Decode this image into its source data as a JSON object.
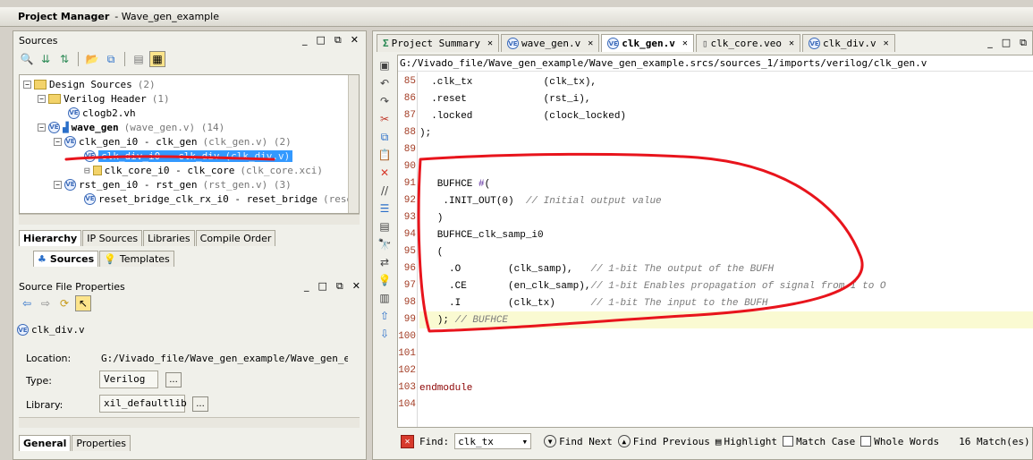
{
  "title_bar": {
    "title": "Project Manager",
    "subtitle": "- Wave_gen_example"
  },
  "sources_panel": {
    "title": "Sources",
    "window_controls": [
      "_",
      "□",
      "⧉",
      "✕"
    ],
    "tree": [
      {
        "label": "Design Sources",
        "meta": "(2)",
        "indent": 0
      },
      {
        "label": "Verilog Header",
        "meta": "(1)",
        "indent": 1
      },
      {
        "label": "clogb2.vh",
        "meta": "",
        "indent": 2
      },
      {
        "label": "wave_gen",
        "meta": "(wave_gen.v) (14)",
        "indent": 1
      },
      {
        "label": "clk_gen_i0 - clk_gen",
        "meta": "(clk_gen.v) (2)",
        "indent": 2
      },
      {
        "label": "clk_div_i0 - clk_div",
        "meta": "(clk_div.v)",
        "indent": 3
      },
      {
        "label": "clk_core_i0 - clk_core",
        "meta": "(clk_core.xci)",
        "indent": 3
      },
      {
        "label": "rst_gen_i0 - rst_gen",
        "meta": "(rst_gen.v) (3)",
        "indent": 2
      },
      {
        "label": "reset_bridge_clk_rx_i0 - reset_bridge",
        "meta": "(reset_b",
        "indent": 3
      }
    ],
    "tabs": [
      "Hierarchy",
      "IP Sources",
      "Libraries",
      "Compile Order"
    ],
    "subtabs": [
      "Sources",
      "Templates"
    ]
  },
  "file_properties": {
    "title": "Source File Properties",
    "file_name": "clk_div.v",
    "location_label": "Location:",
    "location_value": "G:/Vivado_file/Wave_gen_example/Wave_gen_examp",
    "type_label": "Type:",
    "type_value": "Verilog",
    "library_label": "Library:",
    "library_value": "xil_defaultlib",
    "dots": "...",
    "tabs": [
      "General",
      "Properties"
    ]
  },
  "editor_tabs": [
    {
      "label": "Project Summary",
      "active": false
    },
    {
      "label": "wave_gen.v",
      "active": false
    },
    {
      "label": "clk_gen.v",
      "active": true
    },
    {
      "label": "clk_core.veo",
      "active": false
    },
    {
      "label": "clk_div.v",
      "active": false
    }
  ],
  "editor": {
    "path": "G:/Vivado_file/Wave_gen_example/Wave_gen_example.srcs/sources_1/imports/verilog/clk_gen.v",
    "lines": [
      {
        "n": "85",
        "code": "  .clk_tx            (clk_tx),"
      },
      {
        "n": "86",
        "code": "  .reset             (rst_i),"
      },
      {
        "n": "87",
        "code": "  .locked            (clock_locked)"
      },
      {
        "n": "88",
        "code": ");"
      },
      {
        "n": "89",
        "code": ""
      },
      {
        "n": "90",
        "code": ""
      },
      {
        "n": "91",
        "code": "   BUFHCE #("
      },
      {
        "n": "92",
        "code": "    .INIT_OUT(0)  // Initial output value"
      },
      {
        "n": "93",
        "code": "   )"
      },
      {
        "n": "94",
        "code": "   BUFHCE_clk_samp_i0"
      },
      {
        "n": "95",
        "code": "   ("
      },
      {
        "n": "96",
        "code": "     .O        (clk_samp),   // 1-bit The output of the BUFH"
      },
      {
        "n": "97",
        "code": "     .CE       (en_clk_samp),// 1-bit Enables propagation of signal from I to O"
      },
      {
        "n": "98",
        "code": "     .I        (clk_tx)      // 1-bit The input to the BUFH"
      },
      {
        "n": "99",
        "code": "   ); // BUFHCE"
      },
      {
        "n": "100",
        "code": ""
      },
      {
        "n": "101",
        "code": ""
      },
      {
        "n": "102",
        "code": ""
      },
      {
        "n": "103",
        "code": "endmodule"
      },
      {
        "n": "104",
        "code": ""
      }
    ]
  },
  "find_bar": {
    "label": "Find:",
    "value": "clk_tx",
    "find_next": "Find Next",
    "find_previous": "Find Previous",
    "highlight": "Highlight",
    "match_case": "Match Case",
    "whole_words": "Whole Words",
    "matches": "16 Match(es)"
  }
}
